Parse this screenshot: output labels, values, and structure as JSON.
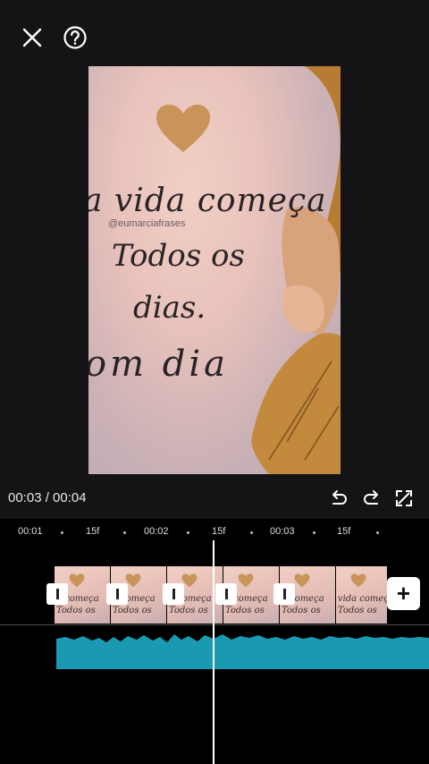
{
  "topbar": {
    "close": "close",
    "help": "help"
  },
  "preview": {
    "line1": "a vida começa",
    "credit": "@eumarciafrases",
    "line2": "Todos os",
    "line3": "dias.",
    "line4": "om dia"
  },
  "playback": {
    "timecode": "00:03 / 00:04"
  },
  "ruler": {
    "labels": [
      "00:01",
      "15f",
      "00:02",
      "15f",
      "00:03",
      "15f"
    ]
  },
  "clips": [
    {
      "text1": "a começa",
      "text2": "Todos os"
    },
    {
      "text1": "a começa",
      "text2": "Todos os"
    },
    {
      "text1": "a começa",
      "text2": "Todos os"
    },
    {
      "text1": "a começa",
      "text2": "Todos os"
    },
    {
      "text1": "a começa",
      "text2": "Todos os"
    },
    {
      "text1": "vida começa",
      "text2": "Todos os"
    }
  ],
  "add_label": "+",
  "colors": {
    "audio": "#1a9ab0",
    "accent_heart": "#c9945a",
    "background": "#141416"
  }
}
